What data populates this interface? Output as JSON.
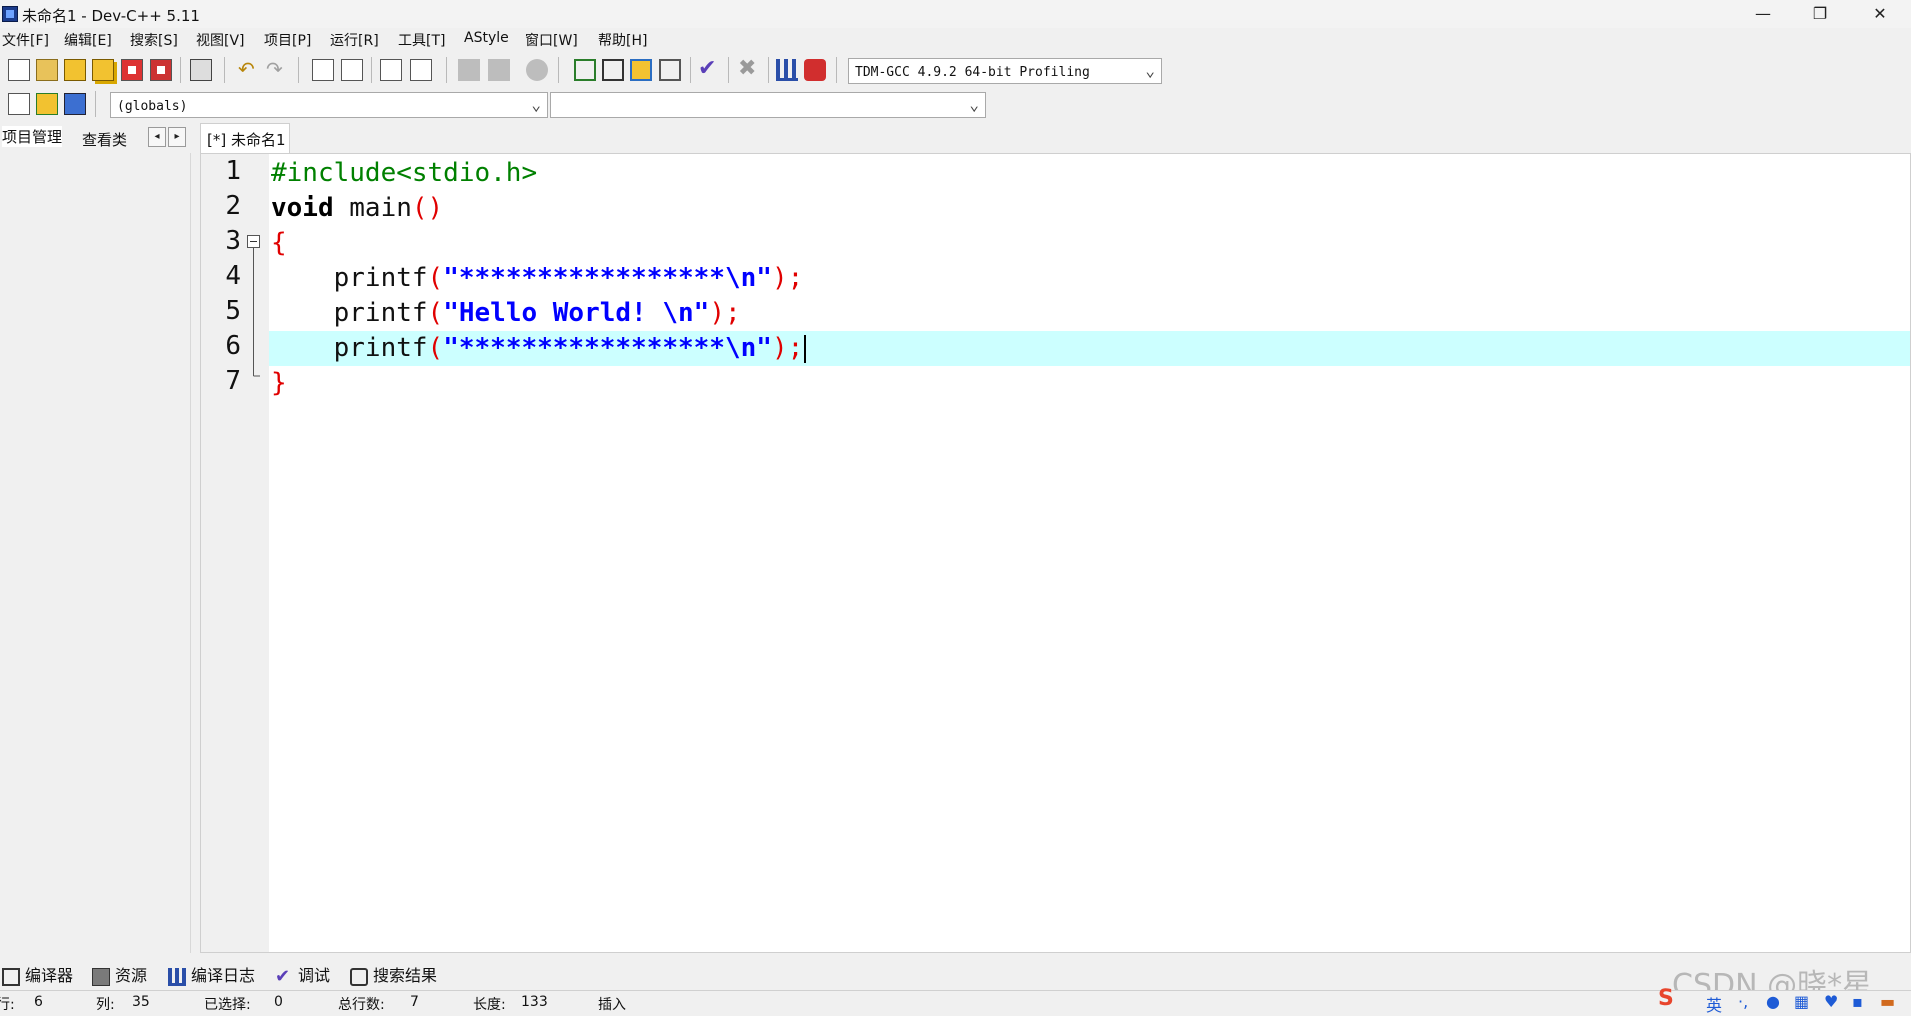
{
  "window": {
    "title": "未命名1 - Dev-C++ 5.11",
    "minimize_glyph": "—",
    "maximize_glyph": "❐",
    "close_glyph": "✕"
  },
  "menu": [
    "文件[F]",
    "编辑[E]",
    "搜索[S]",
    "视图[V]",
    "项目[P]",
    "运行[R]",
    "工具[T]",
    "AStyle",
    "窗口[W]",
    "帮助[H]"
  ],
  "toolbar": {
    "compiler_select": "TDM-GCC 4.9.2 64-bit Profiling",
    "scope_select": "(globals)",
    "member_select": ""
  },
  "left_panel": {
    "tabs": [
      "项目管理",
      "查看类"
    ],
    "prev_glyph": "◂",
    "next_glyph": "▸"
  },
  "editor": {
    "tab_label": "[*] 未命名1",
    "line_numbers": [
      "1",
      "2",
      "3",
      "4",
      "5",
      "6",
      "7"
    ],
    "current_line": 6,
    "lines": [
      [
        {
          "t": "#include<stdio.h>",
          "c": "pre"
        }
      ],
      [
        {
          "t": "void",
          "c": "kw"
        },
        {
          "t": " main",
          "c": "plain"
        },
        {
          "t": "()",
          "c": "sym"
        }
      ],
      [
        {
          "t": "{",
          "c": "sym"
        }
      ],
      [
        {
          "t": "    printf",
          "c": "plain"
        },
        {
          "t": "(",
          "c": "sym"
        },
        {
          "t": "\"*****************\\n\"",
          "c": "str"
        },
        {
          "t": ");",
          "c": "sym"
        }
      ],
      [
        {
          "t": "    printf",
          "c": "plain"
        },
        {
          "t": "(",
          "c": "sym"
        },
        {
          "t": "\"Hello World! \\n\"",
          "c": "str"
        },
        {
          "t": ");",
          "c": "sym"
        }
      ],
      [
        {
          "t": "    printf",
          "c": "plain"
        },
        {
          "t": "(",
          "c": "sym"
        },
        {
          "t": "\"*****************\\n\"",
          "c": "str"
        },
        {
          "t": ");",
          "c": "sym"
        }
      ],
      [
        {
          "t": "}",
          "c": "sym"
        }
      ]
    ]
  },
  "bottom_tabs": [
    {
      "label": "编译器",
      "icon": "compiler-icon"
    },
    {
      "label": "资源",
      "icon": "resources-icon"
    },
    {
      "label": "编译日志",
      "icon": "compile-log-icon"
    },
    {
      "label": "调试",
      "icon": "debug-icon"
    },
    {
      "label": "搜索结果",
      "icon": "search-results-icon"
    }
  ],
  "status": {
    "row_label": "行:",
    "row_value": "6",
    "col_label": "列:",
    "col_value": "35",
    "sel_label": "已选择:",
    "sel_value": "0",
    "lines_label": "总行数:",
    "lines_value": "7",
    "len_label": "长度:",
    "len_value": "133",
    "mode": "插入"
  },
  "watermark": "CSDN @晓*星",
  "tray": {
    "ime": "英"
  },
  "colors": {
    "preprocessor": "#008000",
    "symbol": "#e00000",
    "string": "#0000ff",
    "current_line": "#ccffff"
  }
}
